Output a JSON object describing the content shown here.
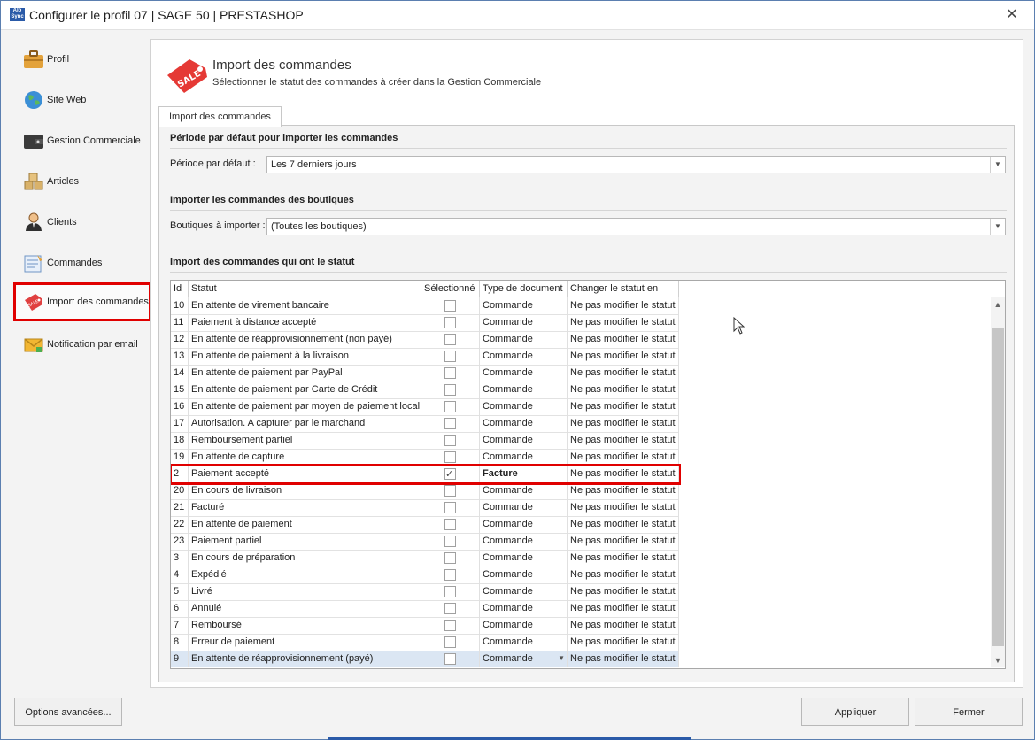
{
  "window": {
    "title": "Configurer le profil 07 | SAGE 50 | PRESTASHOP",
    "app_icon_text": "Alo Sync",
    "close_glyph": "✕"
  },
  "sidebar": {
    "items": [
      {
        "label": "Profil",
        "icon": "briefcase-icon"
      },
      {
        "label": "Site Web",
        "icon": "globe-icon"
      },
      {
        "label": "Gestion Commerciale",
        "icon": "wallet-icon"
      },
      {
        "label": "Articles",
        "icon": "boxes-icon"
      },
      {
        "label": "Clients",
        "icon": "user-icon"
      },
      {
        "label": "Commandes",
        "icon": "order-form-icon"
      },
      {
        "label": "Import des commandes",
        "icon": "sale-tag-icon",
        "active": true
      },
      {
        "label": "Notification par email",
        "icon": "email-icon"
      }
    ]
  },
  "header": {
    "title": "Import des commandes",
    "subtitle": "Sélectionner le statut des commandes à créer dans la Gestion Commerciale",
    "icon": "sale-tag-icon",
    "icon_text": "SALE"
  },
  "tab": {
    "label": "Import des commandes"
  },
  "period": {
    "section_title": "Période par défaut pour importer les commandes",
    "label": "Période par défaut :",
    "value": "Les 7 derniers jours"
  },
  "shops": {
    "section_title": "Importer les commandes des boutiques",
    "label": "Boutiques à importer :",
    "value": "(Toutes les boutiques)"
  },
  "status": {
    "section_title": "Import des commandes qui ont le statut"
  },
  "grid": {
    "columns": [
      "Id",
      "Statut",
      "Sélectionné",
      "Type de document",
      "Changer le statut en"
    ],
    "rows": [
      {
        "id": "10",
        "statut": "En attente de virement bancaire",
        "selected": false,
        "type": "Commande",
        "change": "Ne pas modifier le statut"
      },
      {
        "id": "11",
        "statut": "Paiement à distance accepté",
        "selected": false,
        "type": "Commande",
        "change": "Ne pas modifier le statut"
      },
      {
        "id": "12",
        "statut": "En attente de réapprovisionnement (non payé)",
        "selected": false,
        "type": "Commande",
        "change": "Ne pas modifier le statut"
      },
      {
        "id": "13",
        "statut": "En attente de paiement à la livraison",
        "selected": false,
        "type": "Commande",
        "change": "Ne pas modifier le statut"
      },
      {
        "id": "14",
        "statut": "En attente de paiement par PayPal",
        "selected": false,
        "type": "Commande",
        "change": "Ne pas modifier le statut"
      },
      {
        "id": "15",
        "statut": "En attente de paiement par Carte de Crédit",
        "selected": false,
        "type": "Commande",
        "change": "Ne pas modifier le statut"
      },
      {
        "id": "16",
        "statut": "En attente de paiement par moyen de paiement local",
        "selected": false,
        "type": "Commande",
        "change": "Ne pas modifier le statut"
      },
      {
        "id": "17",
        "statut": "Autorisation. A capturer par le marchand",
        "selected": false,
        "type": "Commande",
        "change": "Ne pas modifier le statut"
      },
      {
        "id": "18",
        "statut": "Remboursement partiel",
        "selected": false,
        "type": "Commande",
        "change": "Ne pas modifier le statut"
      },
      {
        "id": "19",
        "statut": "En attente de capture",
        "selected": false,
        "type": "Commande",
        "change": "Ne pas modifier le statut"
      },
      {
        "id": "2",
        "statut": "Paiement accepté",
        "selected": true,
        "type": "Facture",
        "change": "Ne pas modifier le statut",
        "highlight": true
      },
      {
        "id": "20",
        "statut": "En cours de livraison",
        "selected": false,
        "type": "Commande",
        "change": "Ne pas modifier le statut"
      },
      {
        "id": "21",
        "statut": "Facturé",
        "selected": false,
        "type": "Commande",
        "change": "Ne pas modifier le statut"
      },
      {
        "id": "22",
        "statut": "En attente de paiement",
        "selected": false,
        "type": "Commande",
        "change": "Ne pas modifier le statut"
      },
      {
        "id": "23",
        "statut": "Paiement partiel",
        "selected": false,
        "type": "Commande",
        "change": "Ne pas modifier le statut"
      },
      {
        "id": "3",
        "statut": "En cours de préparation",
        "selected": false,
        "type": "Commande",
        "change": "Ne pas modifier le statut"
      },
      {
        "id": "4",
        "statut": "Expédié",
        "selected": false,
        "type": "Commande",
        "change": "Ne pas modifier le statut"
      },
      {
        "id": "5",
        "statut": "Livré",
        "selected": false,
        "type": "Commande",
        "change": "Ne pas modifier le statut"
      },
      {
        "id": "6",
        "statut": "Annulé",
        "selected": false,
        "type": "Commande",
        "change": "Ne pas modifier le statut"
      },
      {
        "id": "7",
        "statut": "Remboursé",
        "selected": false,
        "type": "Commande",
        "change": "Ne pas modifier le statut"
      },
      {
        "id": "8",
        "statut": "Erreur de paiement",
        "selected": false,
        "type": "Commande",
        "change": "Ne pas modifier le statut"
      },
      {
        "id": "9",
        "statut": "En attente de réapprovisionnement (payé)",
        "selected": false,
        "type": "Commande",
        "change": "Ne pas modifier le statut",
        "focused": true
      }
    ]
  },
  "buttons": {
    "advanced": "Options avancées...",
    "apply": "Appliquer",
    "close": "Fermer"
  },
  "colors": {
    "highlight": "#e00000",
    "focused_row": "#dbe6f3",
    "accent": "#2a5aa8"
  }
}
